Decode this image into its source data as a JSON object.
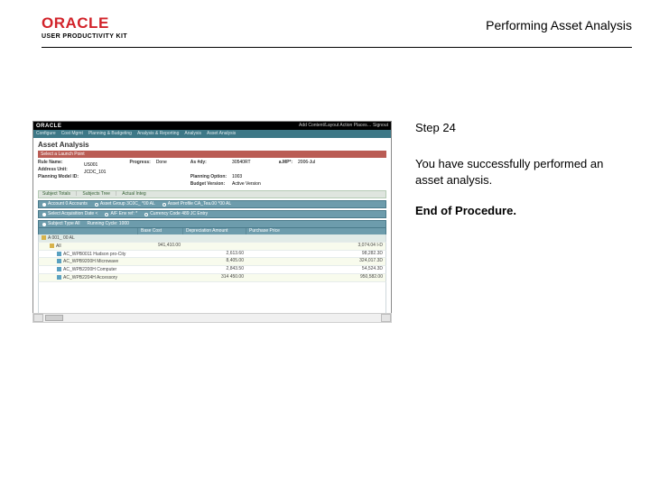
{
  "header": {
    "logo": "ORACLE",
    "subtitle": "USER PRODUCTIVITY KIT",
    "doc_title": "Performing Asset Analysis"
  },
  "instruction": {
    "step": "Step 24",
    "body": "You have successfully performed an asset analysis.",
    "eop": "End of Procedure."
  },
  "shot": {
    "topbar_brand": "ORACLE",
    "topbar_links": "Add Content/Layout    Action Places…    Signout",
    "crumb": [
      "Configure",
      "Cost Mgmt",
      "Planning & Budgeting",
      "Analysis & Reporting",
      "Analysis",
      "Asset Analysis"
    ],
    "title": "Asset Analysis",
    "help_btn": "Select a Launch Point",
    "fields_left_labels": [
      "Rule Name:",
      "Address Unit:",
      "Planning Model ID:"
    ],
    "fields_left_values": [
      "",
      "US001",
      "JCDC_101"
    ],
    "fields_mid_labels": [
      "Progress:",
      "",
      ""
    ],
    "fields_mid_values": [
      "Done",
      "",
      ""
    ],
    "fields_r1_labels": [
      "As #dy:",
      "",
      "Planning Option:",
      "Budget Version:"
    ],
    "fields_r1_values": [
      "30540RT",
      "",
      "1003",
      "Active Version"
    ],
    "fields_r2_labels": [
      "a.MP*:"
    ],
    "fields_r2_values": [
      "2006-Jul"
    ],
    "tabs": [
      "Subject Totals",
      "Subjects Tree",
      "Actual Integ"
    ],
    "filter_items": [
      "Account  0  Accounts",
      "Asset Group  3C0C_ *00 AL",
      "Asset Profile  CA_Tea.00  *00 AL",
      "Select Acquisition Date <",
      "A/F Env ref:  *",
      "Currency Code  489 JC Entry",
      "Subject Type  All",
      "Running Cycle:  1000"
    ],
    "grid_cols": [
      "",
      "Base Cost",
      "Depreciation Amount",
      "Purchase Price"
    ],
    "rows": [
      {
        "label": "A 001_ 00 AL",
        "c2": "",
        "c3": "",
        "c4": ""
      },
      {
        "label": "All",
        "c2": "941,410.00",
        "c3": "",
        "c4": "3,074.04 I-D"
      },
      {
        "label": "AC_WPB0011 Hudson pro-City",
        "c2": "",
        "c3": "2,613.60",
        "c4": "98,282.3D"
      },
      {
        "label": "AC_WPB9200H Microwave",
        "c2": "",
        "c3": "8,405.00",
        "c4": "324,017.3D"
      },
      {
        "label": "AC_WPB2200H Computer",
        "c2": "",
        "c3": "2,843.50",
        "c4": "54,524.3D"
      },
      {
        "label": "AC_WPB2204H Accessory",
        "c2": "",
        "c3": "314 450.00",
        "c4": "950,582.00"
      }
    ]
  }
}
